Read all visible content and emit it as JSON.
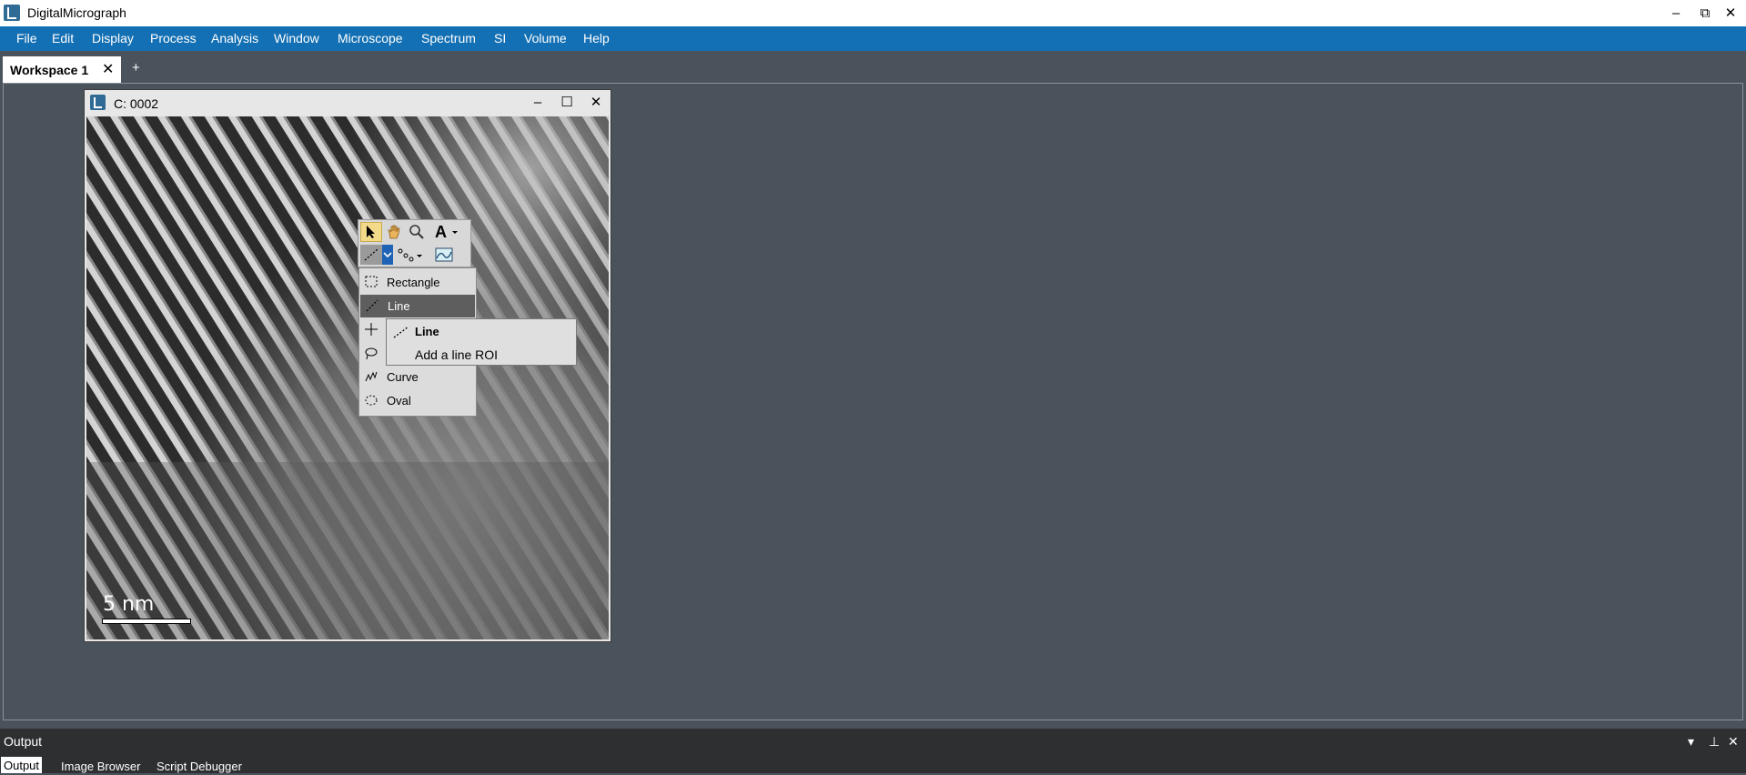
{
  "app": {
    "title": "DigitalMicrograph"
  },
  "window_controls": {
    "minimize": "–",
    "restore": "⧉",
    "close": "✕"
  },
  "menu": [
    "File",
    "Edit",
    "Display",
    "Process",
    "Analysis",
    "Window",
    "Microscope",
    "Spectrum",
    "SI",
    "Volume",
    "Help"
  ],
  "workspace_tabs": {
    "active": "Workspace 1",
    "close": "✕",
    "add": "+"
  },
  "image_window": {
    "title": "C: 0002",
    "controls": {
      "minimize": "–",
      "maximize": "☐",
      "close": "✕"
    },
    "scale_bar_label": "5  nm"
  },
  "roi_menu": {
    "items": [
      {
        "label": "Rectangle",
        "icon": "rectangle-roi-icon"
      },
      {
        "label": "Line",
        "icon": "line-roi-icon",
        "selected": true
      },
      {
        "label": "",
        "icon": "point-roi-icon"
      },
      {
        "label": "",
        "icon": "lasso-roi-icon"
      },
      {
        "label": "Curve",
        "icon": "curve-roi-icon"
      },
      {
        "label": "Oval",
        "icon": "oval-roi-icon"
      }
    ]
  },
  "tooltip": {
    "title": "Line",
    "description": "Add a line ROI"
  },
  "output_panel": {
    "title": "Output",
    "tabs": [
      "Output",
      "Image Browser",
      "Script Debugger"
    ]
  },
  "colors": {
    "menubar": "#1470b4",
    "workspace": "#4a535c",
    "selection": "#5e5e5e"
  }
}
